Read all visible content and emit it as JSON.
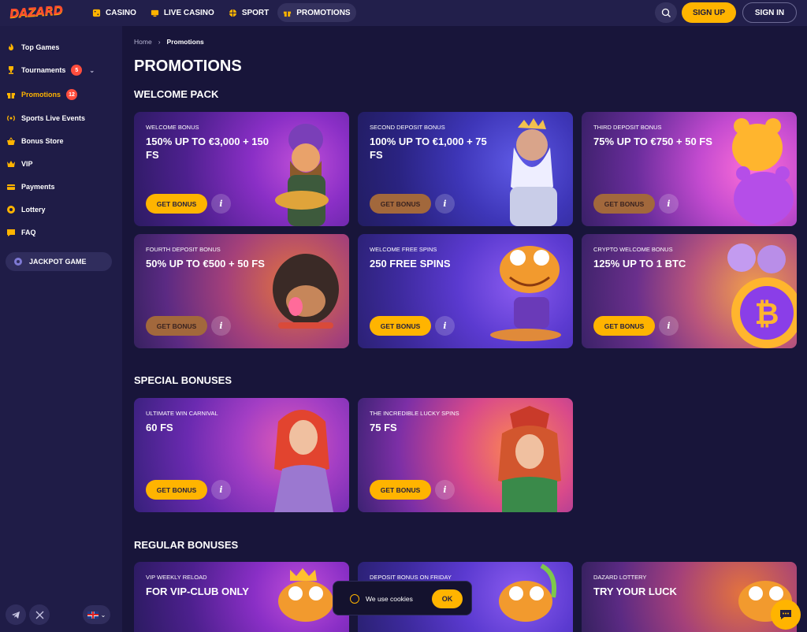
{
  "header": {
    "logo": "DAZARD",
    "nav": [
      {
        "label": "CASINO",
        "icon": "casino-icon"
      },
      {
        "label": "LIVE CASINO",
        "icon": "live-casino-icon"
      },
      {
        "label": "SPORT",
        "icon": "sport-icon"
      },
      {
        "label": "PROMOTIONS",
        "icon": "gift-icon",
        "active": true
      }
    ],
    "search_icon": "search-icon",
    "signup": "SIGN UP",
    "signin": "SIGN IN"
  },
  "sidebar": {
    "items": [
      {
        "label": "Top Games",
        "icon": "fire-icon"
      },
      {
        "label": "Tournaments",
        "icon": "trophy-icon",
        "badge": "5"
      },
      {
        "label": "Promotions",
        "icon": "gift-icon",
        "badge": "12",
        "active": true
      },
      {
        "label": "Sports Live Events",
        "icon": "broadcast-icon"
      },
      {
        "label": "Bonus Store",
        "icon": "basket-icon"
      },
      {
        "label": "VIP",
        "icon": "crown-icon"
      },
      {
        "label": "Payments",
        "icon": "wallet-icon"
      },
      {
        "label": "Lottery",
        "icon": "lottery-icon"
      },
      {
        "label": "FAQ",
        "icon": "faq-icon"
      }
    ],
    "jackpot": "JACKPOT GAME"
  },
  "breadcrumb": {
    "home": "Home",
    "current": "Promotions"
  },
  "page_title": "PROMOTIONS",
  "sections": {
    "welcome": "WELCOME PACK",
    "special": "SPECIAL BONUSES",
    "regular": "REGULAR BONUSES"
  },
  "cards": {
    "welcome": [
      {
        "sub": "WELCOME BONUS",
        "title": "150% UP TO €3,000 + 150 FS",
        "button": "GET BONUS"
      },
      {
        "sub": "SECOND DEPOSIT BONUS",
        "title": "100% UP TO €1,000 + 75 FS",
        "button": "GET BONUS"
      },
      {
        "sub": "THIRD DEPOSIT BONUS",
        "title": "75% UP TO €750 + 50 FS",
        "button": "GET BONUS"
      },
      {
        "sub": "FOURTH DEPOSIT BONUS",
        "title": "50% UP TO €500 + 50 FS",
        "button": "GET BONUS"
      },
      {
        "sub": "WELCOME FREE SPINS",
        "title": "250 FREE SPINS",
        "button": "GET BONUS"
      },
      {
        "sub": "CRYPTO WELCOME BONUS",
        "title": "125% UP TO 1 BTC",
        "button": "GET BONUS"
      }
    ],
    "special": [
      {
        "sub": "ULTIMATE WIN CARNIVAL",
        "title": "60 FS",
        "button": "GET BONUS"
      },
      {
        "sub": "THE INCREDIBLE LUCKY SPINS",
        "title": "75 FS",
        "button": "GET BONUS"
      }
    ],
    "regular": [
      {
        "sub": "VIP WEEKLY RELOAD",
        "title": "FOR VIP-CLUB ONLY"
      },
      {
        "sub": "DEPOSIT BONUS ON FRIDAY",
        "title": ""
      },
      {
        "sub": "DAZARD LOTTERY",
        "title": "TRY YOUR LUCK"
      }
    ],
    "info_glyph": "i"
  },
  "cookie": {
    "text": "We use cookies",
    "ok": "OK"
  },
  "colors": {
    "accent": "#ffb400",
    "badge": "#ff4d3d",
    "bg": "#18153a",
    "sidebar": "#1f1c47"
  }
}
